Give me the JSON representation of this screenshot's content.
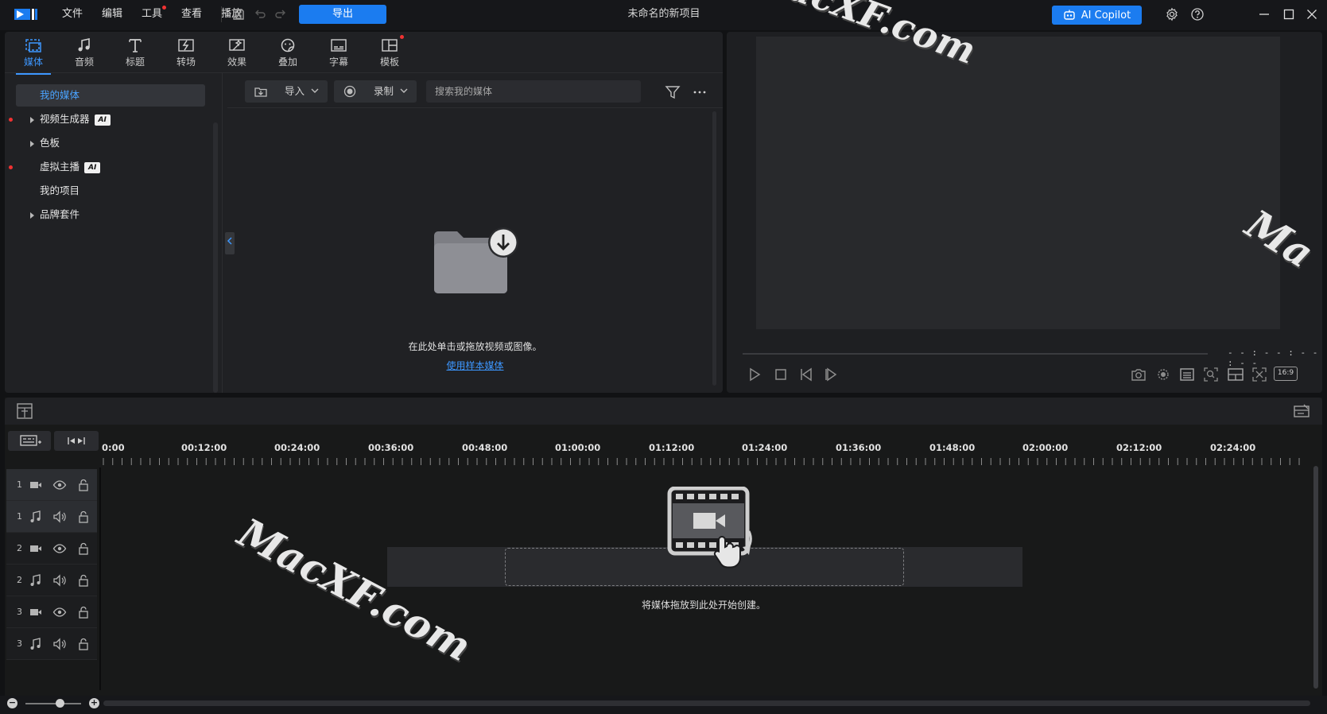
{
  "app": {
    "menu": [
      "文件",
      "编辑",
      "工具",
      "查看",
      "播放"
    ],
    "export_label": "导出",
    "project_title": "未命名的新项目",
    "copilot_label": "AI Copilot"
  },
  "tabs": [
    {
      "label": "媒体",
      "icon": "media-room-icon"
    },
    {
      "label": "音频",
      "icon": "music-note-icon"
    },
    {
      "label": "标题",
      "icon": "title-text-icon"
    },
    {
      "label": "转场",
      "icon": "transition-icon"
    },
    {
      "label": "效果",
      "icon": "effect-icon"
    },
    {
      "label": "叠加",
      "icon": "overlay-sticker-icon"
    },
    {
      "label": "字幕",
      "icon": "subtitle-icon"
    },
    {
      "label": "模板",
      "icon": "template-icon"
    }
  ],
  "tree": {
    "items": [
      {
        "label": "我的媒体"
      },
      {
        "label": "视频生成器",
        "badge": "AI"
      },
      {
        "label": "色板"
      },
      {
        "label": "虚拟主播",
        "badge": "AI"
      },
      {
        "label": "我的项目"
      },
      {
        "label": "品牌套件"
      }
    ]
  },
  "library": {
    "import_label": "导入",
    "record_label": "录制",
    "search_placeholder": "搜索我的媒体",
    "empty_hint": "在此处单击或拖放视频或图像。",
    "sample_link": "使用样本媒体"
  },
  "preview": {
    "timecode": "- - : - - : - - : - -",
    "aspect_ratio": "16:9"
  },
  "timeline": {
    "ruler": [
      "0:00",
      "00:12:00",
      "00:24:00",
      "00:36:00",
      "00:48:00",
      "01:00:00",
      "01:12:00",
      "01:24:00",
      "01:36:00",
      "01:48:00",
      "02:00:00",
      "02:12:00",
      "02:24:00"
    ],
    "tracks": [
      {
        "num": "1",
        "type": "video"
      },
      {
        "num": "1",
        "type": "audio"
      },
      {
        "num": "2",
        "type": "video"
      },
      {
        "num": "2",
        "type": "audio"
      },
      {
        "num": "3",
        "type": "video"
      },
      {
        "num": "3",
        "type": "audio"
      }
    ],
    "drop_hint": "将媒体拖放到此处开始创建。"
  },
  "watermark": {
    "top": "MacXF.com",
    "middle": "MacXF.com",
    "right": "Ma"
  },
  "colors": {
    "accent": "#1b7cf0",
    "link": "#3d97ff",
    "background": "#111214",
    "panel": "#202124",
    "notification_dot": "#f03232"
  }
}
